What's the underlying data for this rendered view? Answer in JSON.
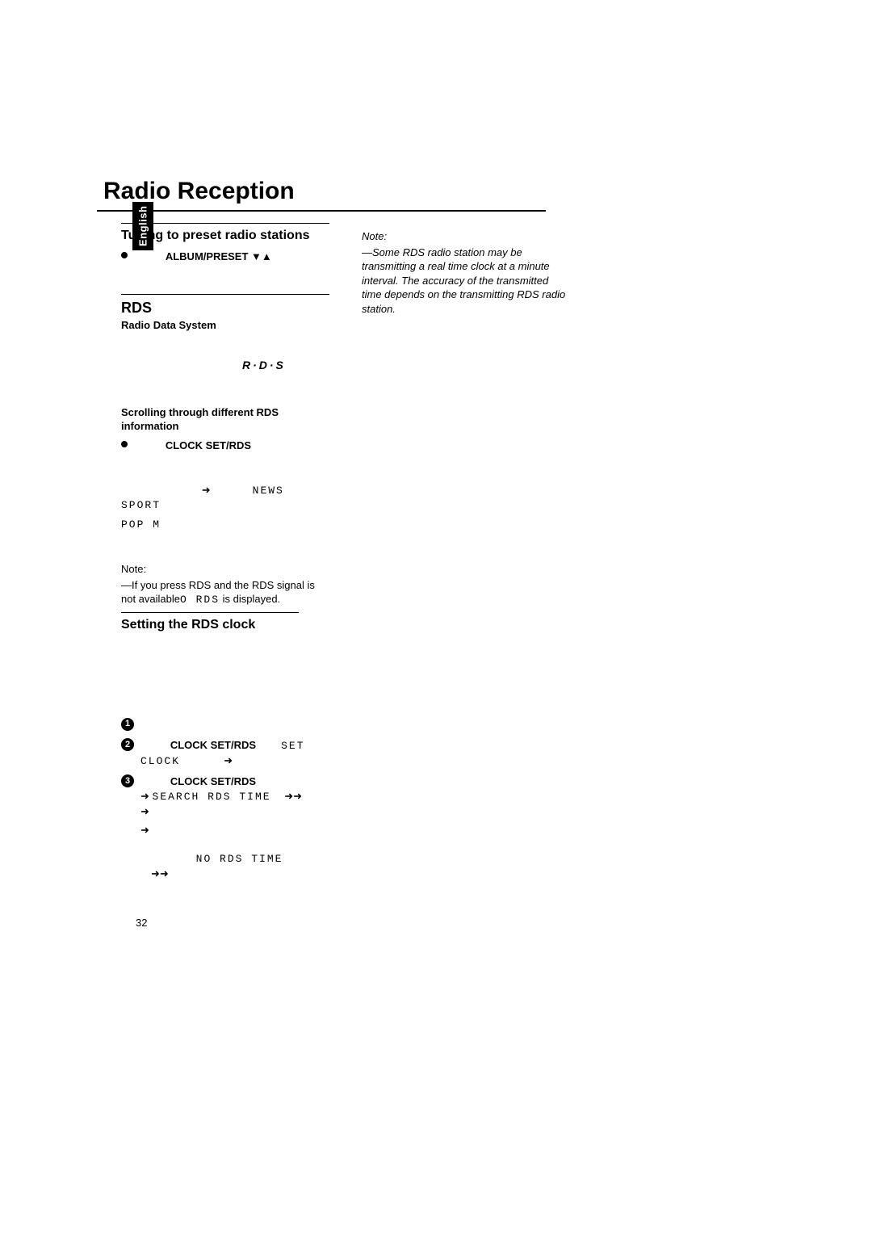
{
  "lang_tab": "English",
  "title": "Radio Reception",
  "left": {
    "tuning_heading": "Tuning to preset radio stations",
    "album_preset_label": "ALBUM/PRESET",
    "triangles": "▼▲",
    "rds_heading": "RDS",
    "rds_sub": "Radio Data System",
    "rds_logo": "R·D·S",
    "scroll_heading": "Scrolling through different RDS information",
    "clock_set_rds": "CLOCK SET/RDS",
    "news": "NEWS",
    "sport": "SPORT",
    "popm": "POP M",
    "note_label": "Note:",
    "note_text1": "—If you press RDS and the RDS signal is not available",
    "no_rds_inline": "O RDS",
    "note_text1b": " is displayed.",
    "setting_heading": "Setting the RDS clock",
    "step2_set": "SET",
    "step2_clock": "CLOCK",
    "step3_prefix": "➜",
    "step3_search": "SEARCH RDS TIME",
    "no_rds_time": "NO RDS TIME"
  },
  "right": {
    "note_label": "Note:",
    "note_text": "—Some RDS radio station may be transmitting a real time clock at a minute interval. The accuracy of the transmitted time depends on the transmitting RDS radio station."
  },
  "page_number": "32"
}
